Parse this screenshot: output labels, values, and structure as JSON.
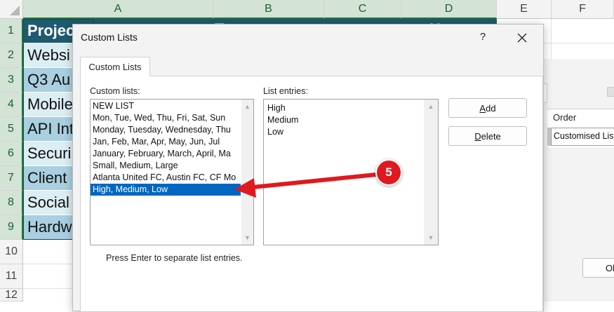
{
  "sheet": {
    "columns": [
      "A",
      "B",
      "C",
      "D",
      "E",
      "F"
    ],
    "rows": [
      "1",
      "2",
      "3",
      "4",
      "5",
      "6",
      "7",
      "8",
      "9",
      "10",
      "11",
      "12"
    ],
    "cells": [
      "Projec",
      "Websi",
      "Q3 Au",
      "Mobile",
      "API Int",
      "Securi",
      "Client",
      "Social",
      "Hardw"
    ],
    "header_fragments": [
      "T",
      "ng",
      "H"
    ]
  },
  "background_sort_dialog": {
    "order_header": "Order",
    "order_value": "Customised Lis",
    "ok_fragment": "Ol"
  },
  "dialog": {
    "title": "Custom Lists",
    "help": "?",
    "tab": "Custom Lists",
    "custom_lists_label": "Custom lists:",
    "custom_lists": [
      "NEW LIST",
      "Mon, Tue, Wed, Thu, Fri, Sat, Sun",
      "Monday, Tuesday, Wednesday, Thu",
      "Jan, Feb, Mar, Apr, May, Jun, Jul",
      "January, February, March, April, Ma",
      "Small, Medium, Large",
      "Atlanta United FC, Austin FC, CF Mo",
      "High, Medium, Low"
    ],
    "list_entries_label": "List entries:",
    "list_entries": [
      "High",
      "Medium",
      "Low"
    ],
    "add_button": {
      "accel": "A",
      "rest": "dd"
    },
    "delete_button": {
      "accel": "D",
      "rest": "elete"
    },
    "hint": "Press Enter to separate list entries."
  },
  "annotation": {
    "number": "5",
    "color": "#e0191f"
  },
  "colors": {
    "header_fill": "#1f5a70",
    "selection": "#0067c0",
    "cell_fill_light": "#dbeef4",
    "cell_fill_mid": "#a9cfe0"
  }
}
